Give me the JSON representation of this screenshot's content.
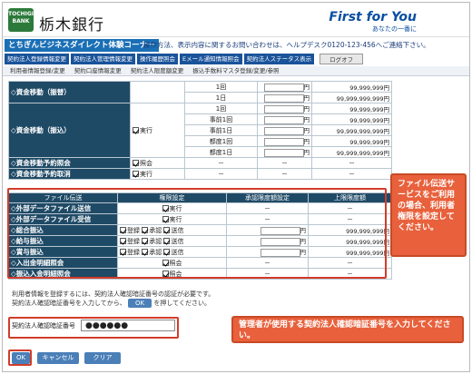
{
  "header": {
    "logo_text": "TOCHIGI BANK",
    "bank_name": "栃木銀行",
    "slogan": "First for You",
    "slogan_sub": "あなたの一番に"
  },
  "title_bar": {
    "title": "とちぎんビジネスダイレクト体験コーナー",
    "help": "操作方法、表示内容に関するお問い合わせは、ヘルプデスク0120-123-456へご連絡下さい。"
  },
  "nav": [
    "契約法人登録情報変更",
    "契約法人管理情報変更",
    "操作履歴照会",
    "Eメール通知情報照会",
    "契約法人ステータス表示",
    "ログオフ"
  ],
  "subnav": [
    "利用者情報登録/変更",
    "契約口座情報変更",
    "契約法人限度額変更",
    "振込手数料マスタ登録/変更/参照"
  ],
  "upper": {
    "rows": [
      {
        "label": "◇資金移動（振替）",
        "items": [
          [
            "1回",
            "円",
            "99,999,999円"
          ],
          [
            "1日",
            "円",
            "99,999,999,999円"
          ]
        ]
      },
      {
        "label": "◇資金移動（振込）",
        "check": "実行",
        "items": [
          [
            "1回",
            "円",
            "99,999,999円"
          ],
          [
            "事前1回",
            "円",
            "99,999,999円"
          ],
          [
            "事前1日",
            "円",
            "99,999,999,999円"
          ],
          [
            "都度1回",
            "円",
            "99,999,999円"
          ],
          [
            "都度1日",
            "円",
            "99,999,999,999円"
          ]
        ]
      },
      {
        "label": "◇資金移動予約照会",
        "check": "照会"
      },
      {
        "label": "◇資金移動予約取消",
        "check": "実行"
      }
    ]
  },
  "lower": {
    "headers": [
      "ファイル伝送",
      "権限設定",
      "承認限度額設定",
      "上限限度額"
    ],
    "rows": [
      {
        "label": "◇外部データファイル送信",
        "checks": [
          "実行"
        ]
      },
      {
        "label": "◇外部データファイル受信",
        "checks": [
          "実行"
        ]
      },
      {
        "label": "◇総合振込",
        "checks": [
          "登録",
          "承認",
          "送信"
        ],
        "amt": "999,999,999円"
      },
      {
        "label": "◇給与振込",
        "checks": [
          "登録",
          "承認",
          "送信"
        ],
        "amt": "999,999,999円"
      },
      {
        "label": "◇賞与振込",
        "checks": [
          "登録",
          "承認",
          "送信"
        ],
        "amt": "999,999,999円"
      },
      {
        "label": "◇入出金明細照会",
        "checks": [
          "照会"
        ]
      },
      {
        "label": "◇振込入金明細照会",
        "checks": [
          "照会"
        ]
      }
    ]
  },
  "dash": "－",
  "info": {
    "line1": "利用者情報を登録するには、契約法人確認暗証番号の認証が必要です。",
    "line2a": "契約法人確認暗証番号を入力してから、",
    "line2b": "を押してください。",
    "ok": "OK"
  },
  "pw": {
    "label": "契約法人確認暗証番号",
    "value": "●●●●●●"
  },
  "buttons": {
    "ok": "OK",
    "cancel": "キャンセル",
    "clear": "クリア"
  },
  "callouts": {
    "c1": "ファイル伝送サービスをご利用の場合、利用者権限を設定してください。",
    "c2": "管理者が使用する契約法人確認暗証番号を入力してください。"
  }
}
